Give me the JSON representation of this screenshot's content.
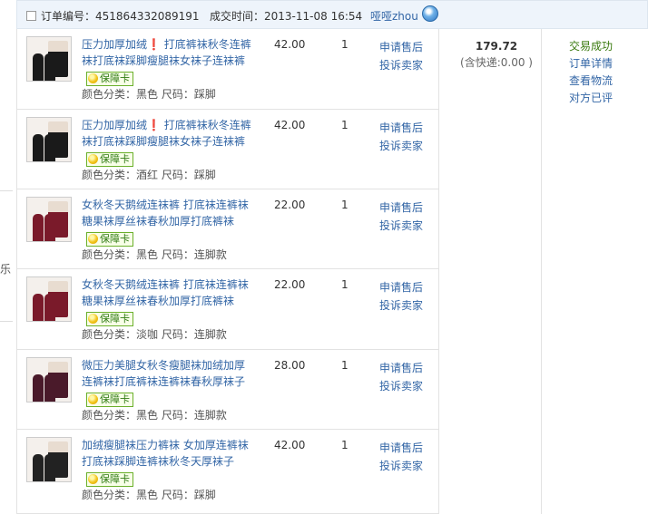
{
  "page_left": {
    "char": "乐"
  },
  "order": {
    "order_no_label": "订单编号：",
    "order_no": "451864332089191",
    "time_label": "成交时间：",
    "time": "2013-11-08 16:54",
    "seller": "哑哑zhou",
    "seller_icon": "aliwangwang-icon",
    "total": "179.72",
    "shipping_note": "(含快递:0.00 )",
    "status": "交易成功",
    "status_links": [
      "订单详情",
      "查看物流",
      "对方已评"
    ]
  },
  "items": [
    {
      "title": "压力加厚加绒❗ 打底裤袜秋冬连裤袜打底袜踩脚瘦腿袜女袜子连袜裤",
      "badge": "保障卡",
      "attrs": "颜色分类：黑色  尺码：踩脚",
      "price": "42.00",
      "qty": "1",
      "action1": "申请售后",
      "action2": "投诉卖家",
      "thumb_color": "#1a1a1a"
    },
    {
      "title": "压力加厚加绒❗ 打底裤袜秋冬连裤袜打底袜踩脚瘦腿袜女袜子连袜裤",
      "badge": "保障卡",
      "attrs": "颜色分类：酒红  尺码：踩脚",
      "price": "42.00",
      "qty": "1",
      "action1": "申请售后",
      "action2": "投诉卖家",
      "thumb_color": "#1a1a1a"
    },
    {
      "title": "女秋冬天鹅绒连袜裤 打底袜连裤袜糖果袜厚丝袜春秋加厚打底裤袜",
      "badge": "保障卡",
      "attrs": "颜色分类：黑色  尺码：连脚款",
      "price": "22.00",
      "qty": "1",
      "action1": "申请售后",
      "action2": "投诉卖家",
      "thumb_color": "#7a1a2a"
    },
    {
      "title": "女秋冬天鹅绒连袜裤 打底袜连裤袜糖果袜厚丝袜春秋加厚打底裤袜",
      "badge": "保障卡",
      "attrs": "颜色分类：淡咖  尺码：连脚款",
      "price": "22.00",
      "qty": "1",
      "action1": "申请售后",
      "action2": "投诉卖家",
      "thumb_color": "#7a1a2a"
    },
    {
      "title": "微压力美腿女秋冬瘦腿袜加绒加厚连裤袜打底裤袜连裤袜春秋厚袜子",
      "badge": "保障卡",
      "attrs": "颜色分类：黑色  尺码：连脚款",
      "price": "28.00",
      "qty": "1",
      "action1": "申请售后",
      "action2": "投诉卖家",
      "thumb_color": "#4a1a2a"
    },
    {
      "title": "加绒瘦腿袜压力裤袜 女加厚连裤袜打底袜踩脚连裤袜秋冬天厚袜子",
      "badge": "保障卡",
      "attrs": "颜色分类：黑色  尺码：踩脚",
      "price": "42.00",
      "qty": "1",
      "action1": "申请售后",
      "action2": "投诉卖家",
      "thumb_color": "#222222"
    }
  ],
  "colors": {
    "link": "#3366a6",
    "success": "#3a7a0f",
    "header_bg": "#eef4fb",
    "badge_border": "#6bb02b"
  }
}
